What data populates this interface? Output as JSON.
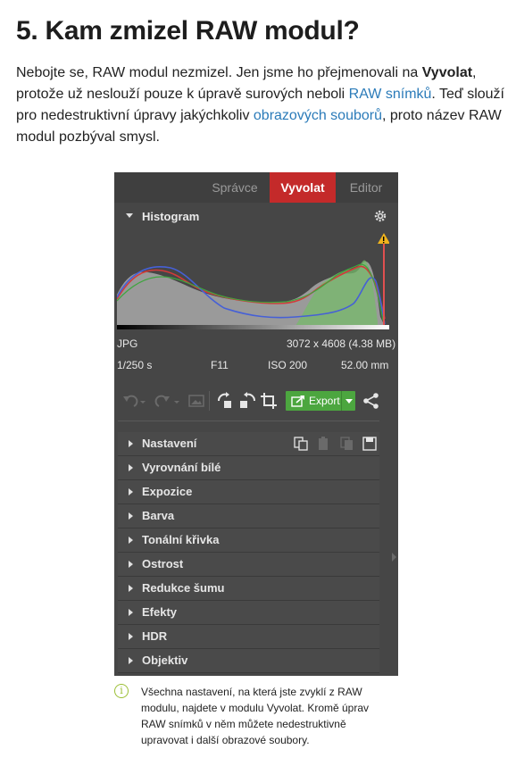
{
  "article": {
    "title": "5. Kam zmizel RAW modul?",
    "intro": {
      "p1": "Nebojte se, RAW modul nezmizel. Jen jsme ho přejmenovali na ",
      "b1": "Vyvolat",
      "p2": ", protože už neslouží pouze k úpravě surových neboli ",
      "link1": "RAW snímků",
      "p3": ". Teď slouží pro nedestruktivní úpravy jakýchkoliv ",
      "link2": "obrazových souborů",
      "p4": ", proto název RAW modul pozbýval smysl."
    },
    "link_color": "#2b7bb9"
  },
  "panel": {
    "tabs": [
      {
        "label": "Správce",
        "active": false
      },
      {
        "label": "Vyvolat",
        "active": true
      },
      {
        "label": "Editor",
        "active": false
      }
    ],
    "active_color": "#c42a2a",
    "histogram": {
      "title": "Histogram",
      "format": "JPG",
      "dimensions": "3072 x 4608 (4.38 MB)",
      "shutter": "1/250 s",
      "aperture": "F11",
      "iso": "ISO 200",
      "focal": "52.00 mm",
      "warning_icon": "warning-triangle-icon",
      "settings_icon": "gear-icon"
    },
    "toolbar": {
      "export_label": "Export",
      "export_color": "#4ca63f",
      "icons": [
        "undo-icon",
        "redo-icon",
        "image-icon",
        "rotate-left-icon",
        "rotate-right-icon",
        "crop-icon",
        "share-icon"
      ]
    },
    "sections": [
      {
        "label": "Nastavení"
      },
      {
        "label": "Vyrovnání bílé"
      },
      {
        "label": "Expozice"
      },
      {
        "label": "Barva"
      },
      {
        "label": "Tonální křivka"
      },
      {
        "label": "Ostrost"
      },
      {
        "label": "Redukce šumu"
      },
      {
        "label": "Efekty"
      },
      {
        "label": "HDR"
      },
      {
        "label": "Objektiv"
      }
    ],
    "preset_icons": [
      "copy-settings-icon",
      "paste-settings-icon",
      "duplicate-icon",
      "save-icon"
    ]
  },
  "caption": {
    "icon": "info-icon",
    "text": "Všechna nastavení, na která jste zvyklí z RAW modulu, najdete v modulu Vyvolat. Kromě úprav RAW snímků v něm můžete nedestruktivně upravovat i další obrazové soubory."
  }
}
